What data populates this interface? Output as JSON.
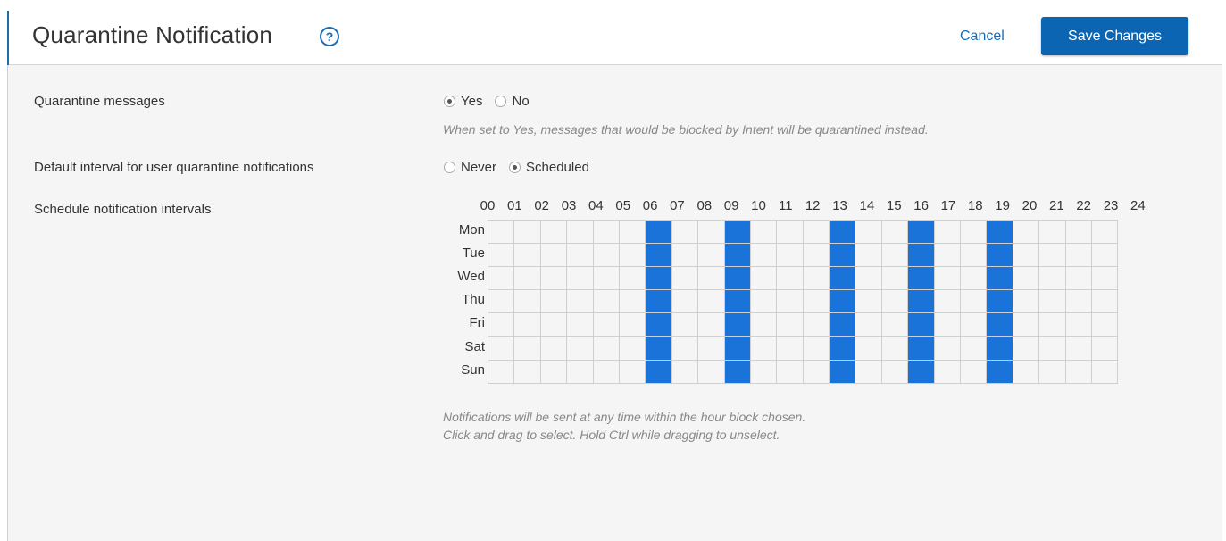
{
  "header": {
    "title": "Quarantine Notification",
    "help_glyph": "?",
    "cancel_label": "Cancel",
    "save_label": "Save Changes"
  },
  "quarantine_messages": {
    "label": "Quarantine messages",
    "options": [
      {
        "label": "Yes",
        "checked": true
      },
      {
        "label": "No",
        "checked": false
      }
    ],
    "hint": "When set to Yes, messages that would be blocked by Intent will be quarantined instead."
  },
  "default_interval": {
    "label": "Default interval for user quarantine notifications",
    "options": [
      {
        "label": "Never",
        "checked": false
      },
      {
        "label": "Scheduled",
        "checked": true
      }
    ]
  },
  "schedule": {
    "label": "Schedule notification intervals",
    "hours": [
      "00",
      "01",
      "02",
      "03",
      "04",
      "05",
      "06",
      "07",
      "08",
      "09",
      "10",
      "11",
      "12",
      "13",
      "14",
      "15",
      "16",
      "17",
      "18",
      "19",
      "20",
      "21",
      "22",
      "23",
      "24"
    ],
    "days": [
      "Mon",
      "Tue",
      "Wed",
      "Thu",
      "Fri",
      "Sat",
      "Sun"
    ],
    "selected_hours": [
      6,
      9,
      13,
      16,
      19
    ],
    "hint_line1": "Notifications will be sent at any time within the hour block chosen.",
    "hint_line2": "Click and drag to select. Hold Ctrl while dragging to unselect."
  },
  "colors": {
    "accent": "#1a6db3",
    "save_button": "#0b65b2",
    "selected_cell": "#1a73d9"
  }
}
